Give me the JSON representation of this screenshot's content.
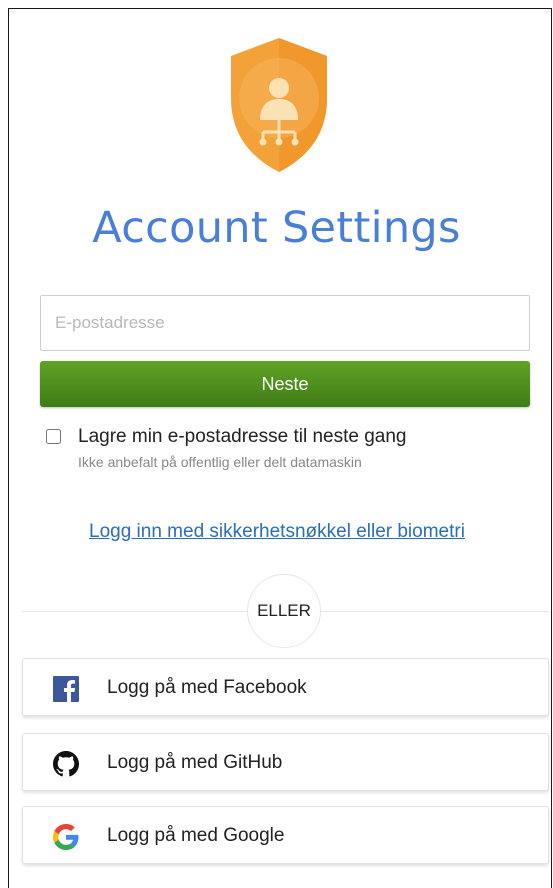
{
  "header": {
    "logo_icon": "shield-user-icon",
    "title": "Account Settings",
    "title_color": "#4a7fd8",
    "logo_color": "#f3a23a"
  },
  "form": {
    "email_placeholder": "E-postadresse",
    "email_value": "",
    "next_label": "Neste",
    "next_color": "#4f901e",
    "remember_label": "Lagre min e-postadresse til neste gang",
    "remember_hint": "Ikke anbefalt på offentlig eller delt datamaskin",
    "remember_checked": false
  },
  "alt_login": {
    "link_text": "Logg inn med sikkerhetsnøkkel eller biometri",
    "or_text": "ELLER"
  },
  "social": [
    {
      "label": "Logg på med Facebook",
      "icon": "facebook-icon"
    },
    {
      "label": "Logg på med GitHub",
      "icon": "github-icon"
    },
    {
      "label": "Logg på med Google",
      "icon": "google-icon"
    }
  ]
}
